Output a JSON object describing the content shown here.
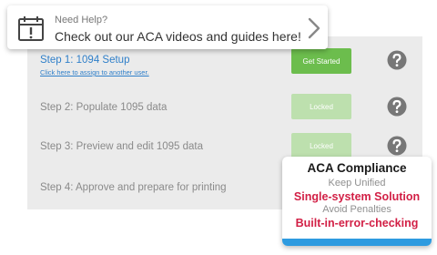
{
  "help_banner": {
    "title": "Need Help?",
    "text": "Check out our ACA videos and guides here!",
    "icon": "calendar-alert-icon"
  },
  "steps": [
    {
      "title": "Step 1: 1094 Setup",
      "link": "Click here to assign to another user.",
      "button": "Get Started",
      "state": "active"
    },
    {
      "title": "Step 2: Populate 1095 data",
      "button": "Locked",
      "state": "locked"
    },
    {
      "title": "Step 3: Preview and edit 1095 data",
      "button": "Locked",
      "state": "locked"
    },
    {
      "title": "Step 4: Approve and prepare for printing"
    }
  ],
  "compliance_card": {
    "title": "ACA Compliance",
    "line1": "Keep Unified",
    "line2": "Single-system Solution",
    "line3": "Avoid Penalties",
    "line4": "Built-in-error-checking"
  },
  "colors": {
    "accent_blue": "#2f7fc9",
    "active_green": "#6cbd4d",
    "locked_green": "#bde0ae",
    "highlight_red": "#d21f45",
    "card_bar_blue": "#2e9be0"
  }
}
